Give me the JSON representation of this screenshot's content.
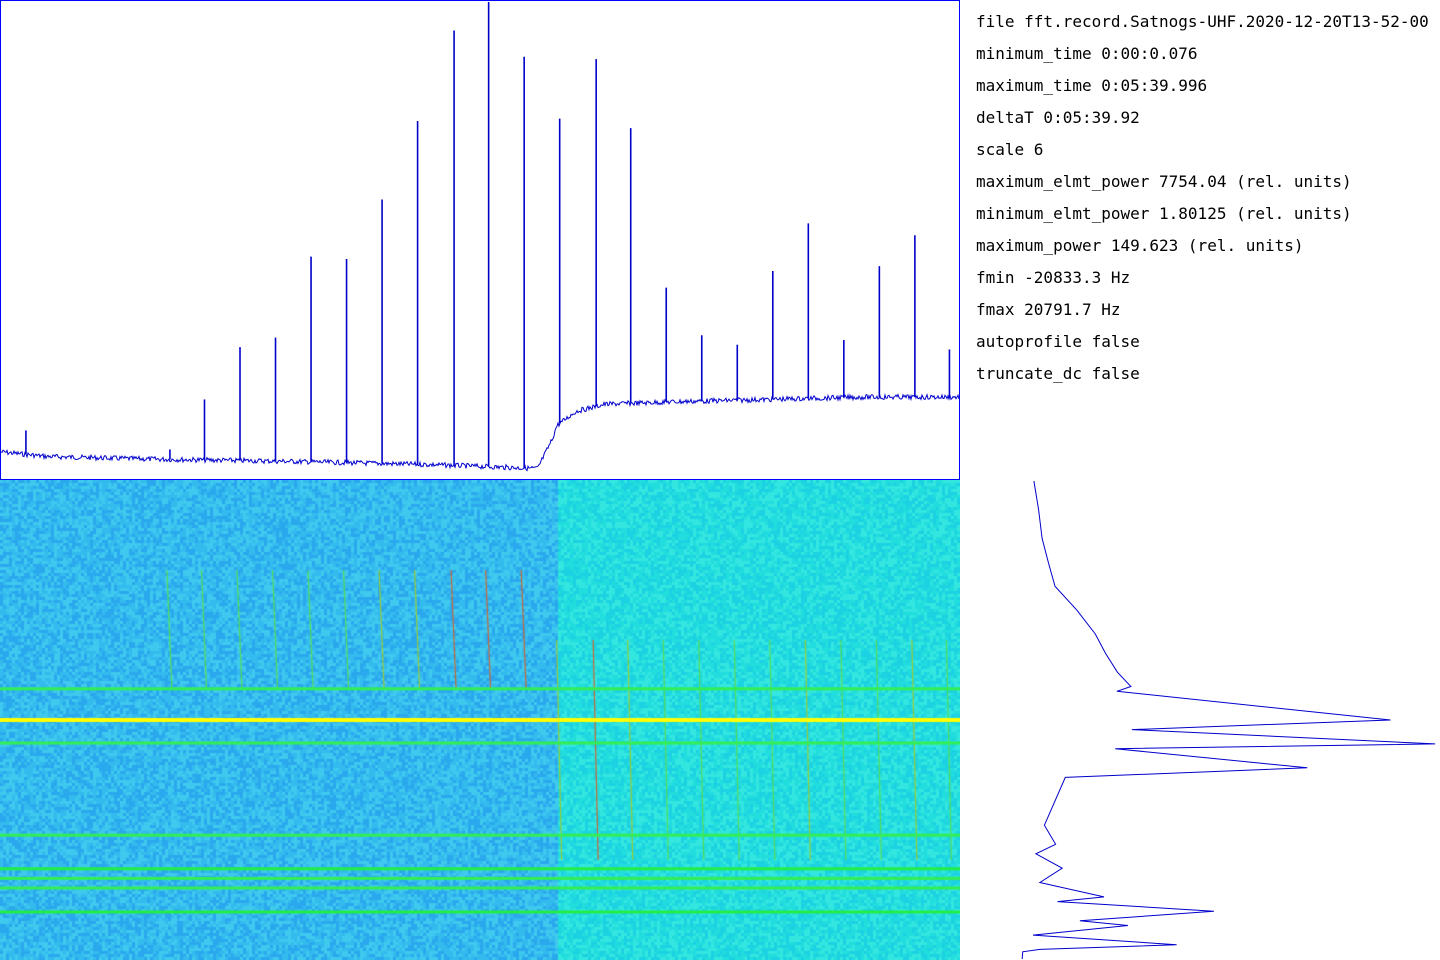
{
  "info": {
    "file": "file fft.record.Satnogs-UHF.2020-12-20T13-52-00",
    "minimum_time": "minimum_time  0:00:0.076",
    "maximum_time": "maximum_time  0:05:39.996",
    "deltaT": "deltaT  0:05:39.92",
    "scale": "scale 6",
    "maximum_elmt_power": "maximum_elmt_power 7754.04 (rel. units)",
    "minimum_elmt_power": "minimum_elmt_power 1.80125 (rel. units)",
    "maximum_power": "maximum_power 149.623 (rel. units)",
    "fmin": "fmin -20833.3     Hz",
    "fmax": "fmax 20791.7      Hz",
    "autoprofile": "autoprofile false",
    "truncate_dc": "truncate_dc false"
  },
  "colors": {
    "trace": "#0000cc",
    "axis": "#0000ff",
    "noise": "#33bbee",
    "noise_right": "#22dddd",
    "band_yellow": "#ffff00",
    "band_green": "#33ee55"
  },
  "chart_data": [
    {
      "type": "line",
      "name": "frequency-profile",
      "baseline": {
        "x": [
          0,
          0.05,
          0.15,
          0.3,
          0.45,
          0.56,
          0.575,
          0.58,
          0.6,
          0.63,
          0.7,
          0.8,
          0.9,
          1.0
        ],
        "y": [
          0.055,
          0.045,
          0.04,
          0.035,
          0.028,
          0.02,
          0.08,
          0.11,
          0.14,
          0.155,
          0.16,
          0.165,
          0.17,
          0.17
        ]
      },
      "spikes": {
        "x": [
          0.027,
          0.177,
          0.213,
          0.25,
          0.287,
          0.324,
          0.361,
          0.398,
          0.435,
          0.473,
          0.509,
          0.546,
          0.583,
          0.621,
          0.657,
          0.694,
          0.731,
          0.768,
          0.805,
          0.842,
          0.879,
          0.916,
          0.953,
          0.989
        ],
        "y": [
          0.1,
          0.06,
          0.165,
          0.275,
          0.295,
          0.465,
          0.46,
          0.585,
          0.75,
          0.94,
          1.0,
          0.885,
          0.755,
          0.88,
          0.735,
          0.4,
          0.3,
          0.28,
          0.435,
          0.535,
          0.29,
          0.445,
          0.51,
          0.27
        ]
      }
    },
    {
      "type": "heatmap",
      "name": "waterfall",
      "split_x": 0.58,
      "bands_y": [
        0.435,
        0.5,
        0.548,
        0.74,
        0.81,
        0.83,
        0.85,
        0.9
      ],
      "bands_strength": [
        0.6,
        1.0,
        0.7,
        0.5,
        0.8,
        0.7,
        0.6,
        0.8
      ]
    },
    {
      "type": "line",
      "name": "time-profile",
      "x": [
        0.155,
        0.16,
        0.17,
        0.18,
        0.2,
        0.24,
        0.28,
        0.3,
        0.33,
        0.36,
        0.33,
        0.9,
        0.36,
        0.99,
        0.32,
        0.72,
        0.22,
        0.18,
        0.2,
        0.16,
        0.21,
        0.17,
        0.3,
        0.2,
        0.53,
        0.25,
        0.35,
        0.15,
        0.45,
        0.17,
        0.13,
        0.13
      ],
      "y": [
        0.0,
        0.06,
        0.12,
        0.17,
        0.22,
        0.27,
        0.32,
        0.36,
        0.4,
        0.43,
        0.44,
        0.5,
        0.52,
        0.55,
        0.56,
        0.6,
        0.62,
        0.72,
        0.76,
        0.78,
        0.81,
        0.84,
        0.87,
        0.88,
        0.9,
        0.92,
        0.93,
        0.95,
        0.97,
        0.98,
        0.985,
        1.0
      ]
    }
  ]
}
